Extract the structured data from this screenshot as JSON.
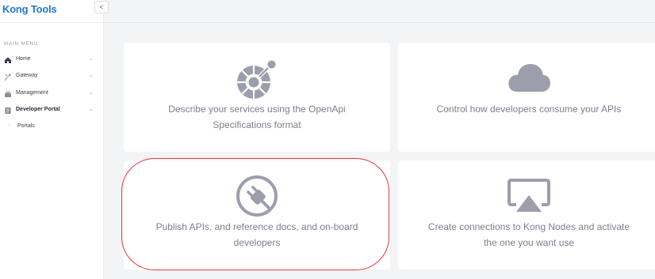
{
  "brand": {
    "name": "Kong Tools",
    "collapse_glyph": "<"
  },
  "sidebar": {
    "section_title": "MAIN MENU",
    "items": [
      {
        "label": "Home",
        "icon": "home-icon"
      },
      {
        "label": "Gateway",
        "icon": "gateway-icon"
      },
      {
        "label": "Management",
        "icon": "management-icon"
      },
      {
        "label": "Developer Portal",
        "icon": "developer-portal-icon"
      }
    ],
    "sub_items": [
      {
        "label": "Portals"
      }
    ]
  },
  "cards": [
    {
      "text_line1": "Describe your services using the OpenApi",
      "text_line2": "Specifications format",
      "icon": "openapi-icon"
    },
    {
      "text_line1": "Control how developers consume your APIs",
      "text_line2": "",
      "icon": "cloud-icon"
    },
    {
      "text_line1": "Publish APIs, and reference docs, and on-board",
      "text_line2": "developers",
      "icon": "plug-icon"
    },
    {
      "text_line1": "Create connections to Kong Nodes and activate",
      "text_line2": "the one you want use",
      "icon": "connection-icon"
    }
  ],
  "colors": {
    "brand": "#1e78d6",
    "icon_gray": "#9c9fab",
    "highlight": "#e23a3a"
  }
}
